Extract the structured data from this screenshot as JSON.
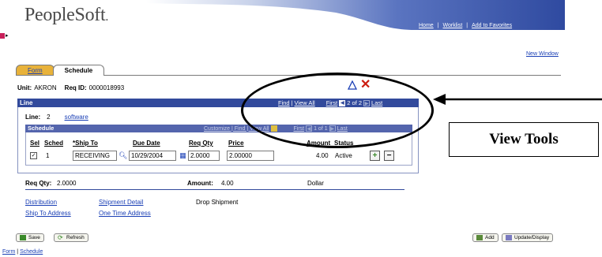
{
  "header": {
    "logo": "PeopleSoft",
    "nav_links": [
      "Home",
      "Worklist",
      "Add to Favorites"
    ],
    "new_window": "New Window"
  },
  "tabs": [
    {
      "label": "Form",
      "active": false
    },
    {
      "label": "Schedule",
      "active": true
    }
  ],
  "unit": {
    "label": "Unit:",
    "value": "AKRON",
    "req_label": "Req ID:",
    "req_value": "0000018993"
  },
  "line_bar": {
    "title": "Line",
    "find": "Find",
    "view_all": "View All",
    "first": "First",
    "counter": "2 of 2",
    "last": "Last"
  },
  "line_row": {
    "label": "Line:",
    "number": "2",
    "item": "software"
  },
  "schedule": {
    "title": "Schedule",
    "nav_text": "Customize | Find | View All",
    "first": "First",
    "counter": "1 of 1",
    "last": "Last",
    "columns": [
      "Sel",
      "Sched",
      "*Ship To",
      "Due Date",
      "Req Qty",
      "Price",
      "Amount",
      "Status"
    ],
    "row": {
      "checked": "✓",
      "sched": "1",
      "ship_to": "RECEIVING",
      "due_date": "10/29/2004",
      "req_qty": "2.0000",
      "price": "2.00000",
      "amount": "4.00",
      "status": "Active"
    }
  },
  "totals": {
    "req_qty_label": "Req Qty:",
    "req_qty_value": "2.0000",
    "amount_label": "Amount:",
    "amount_value": "4.00",
    "currency": "Dollar"
  },
  "links": {
    "distribution": "Distribution",
    "shipment_detail": "Shipment Detail",
    "drop_shipment": "Drop Shipment",
    "ship_to_address": "Ship To Address",
    "one_time_address": "One Time Address"
  },
  "toolbar": {
    "save": "Save",
    "refresh": "Refresh",
    "add": "Add",
    "update_display": "Update/Display"
  },
  "bottom_links": {
    "form": "Form",
    "schedule": "Schedule"
  },
  "callout": {
    "label": "View Tools"
  },
  "colors": {
    "bar": "#324a9c",
    "tab": "#e8b23a",
    "link": "#1a3fb5"
  }
}
